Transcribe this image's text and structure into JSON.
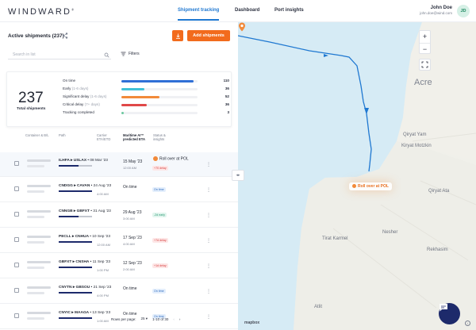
{
  "header": {
    "logo": "WINDWARD",
    "nav": [
      "Shipment tracking",
      "Dashboard",
      "Port insights"
    ],
    "user_name": "John Doe",
    "user_email": "john.doe@wind.com",
    "avatar": "JD"
  },
  "panel": {
    "title": "Active shipments (237)",
    "add_button": "Add shipments",
    "search_placeholder": "Search in list",
    "filters_label": "Filters"
  },
  "summary": {
    "total": "237",
    "total_label": "Total shipments",
    "rows": [
      {
        "label": "On time",
        "sub": "",
        "count": "110",
        "color": "#2f6fd6",
        "fraction": 0.95
      },
      {
        "label": "Early",
        "sub": "(1-6 days)",
        "count": "36",
        "color": "#41c1d8",
        "fraction": 0.3
      },
      {
        "label": "Significant delay",
        "sub": "(1-6 days)",
        "count": "52",
        "color": "#f28a3a",
        "fraction": 0.5
      },
      {
        "label": "Critical delay",
        "sub": "(7+ days)",
        "count": "36",
        "color": "#e04848",
        "fraction": 0.33
      },
      {
        "label": "Tracking completed",
        "sub": "",
        "count": "3",
        "color": "#6dc9a0",
        "fraction": 0.03
      }
    ]
  },
  "table": {
    "headers": {
      "container": "Container & B/L",
      "path": "Path",
      "carrier": "Carrier ETA/ETD",
      "maritime": "Maritime AI™ predicted ETA",
      "status": "Status & insights"
    },
    "rows": [
      {
        "from": "ILHFA",
        "to": "USLAX",
        "date": "08 Mar '23",
        "time": "",
        "eta": "15 May '23",
        "eta_time": "12:00 AM",
        "badge": "+70 delay",
        "badge_type": "late",
        "alert": "Roll over at POL",
        "line": "part",
        "selected": true
      },
      {
        "from": "CNDGG",
        "to": "CAVAN",
        "date": "24 Aug '23",
        "time": "4:00 AM",
        "eta": "On time",
        "eta_time": "",
        "badge": "On time",
        "badge_type": "on",
        "alert": "",
        "line": "full",
        "selected": false
      },
      {
        "from": "CNNGB",
        "to": "GBFXT",
        "date": "31 Aug '23",
        "time": "",
        "eta": "29 Aug '23",
        "eta_time": "3:00 AM",
        "badge": "-2d early",
        "badge_type": "early",
        "alert": "",
        "line": "part",
        "selected": false
      },
      {
        "from": "PECLL",
        "to": "CNHUA",
        "date": "10 Sep '23",
        "time": "12:00 AM",
        "eta": "17 Sep '23",
        "eta_time": "4:00 AM",
        "badge": "+7d delay",
        "badge_type": "late",
        "alert": "",
        "line": "full",
        "selected": false
      },
      {
        "from": "GBFXT",
        "to": "CNSHA",
        "date": "11 Sep '23",
        "time": "1:00 PM",
        "eta": "12 Sep '23",
        "eta_time": "2:00 AM",
        "badge": "+1d delay",
        "badge_type": "late",
        "alert": "",
        "line": "full",
        "selected": false
      },
      {
        "from": "CNYTN",
        "to": "GBSOU",
        "date": "21 Sep '23",
        "time": "4:00 PM",
        "eta": "On time",
        "eta_time": "",
        "badge": "On time",
        "badge_type": "on",
        "alert": "",
        "line": "full",
        "selected": false
      },
      {
        "from": "CNYIC",
        "to": "MAAGA",
        "date": "13 Sep '23",
        "time": "1:00 AM",
        "eta": "On time",
        "eta_time": "",
        "badge": "On time",
        "badge_type": "on",
        "alert": "",
        "line": "full",
        "selected": false
      }
    ],
    "pager": {
      "rows_label": "Rows per page:",
      "rows_value": "25",
      "range": "1-10 of 30"
    }
  },
  "map": {
    "places": [
      "Acre",
      "Qiryat Yam",
      "Kiryat Motzkin",
      "Qiryat Ata",
      "Nesher",
      "Tirat Karmel",
      "Rekhasim",
      "Atlit"
    ],
    "rollover_label": "Roll over at POL",
    "attribution": "mapbox"
  }
}
